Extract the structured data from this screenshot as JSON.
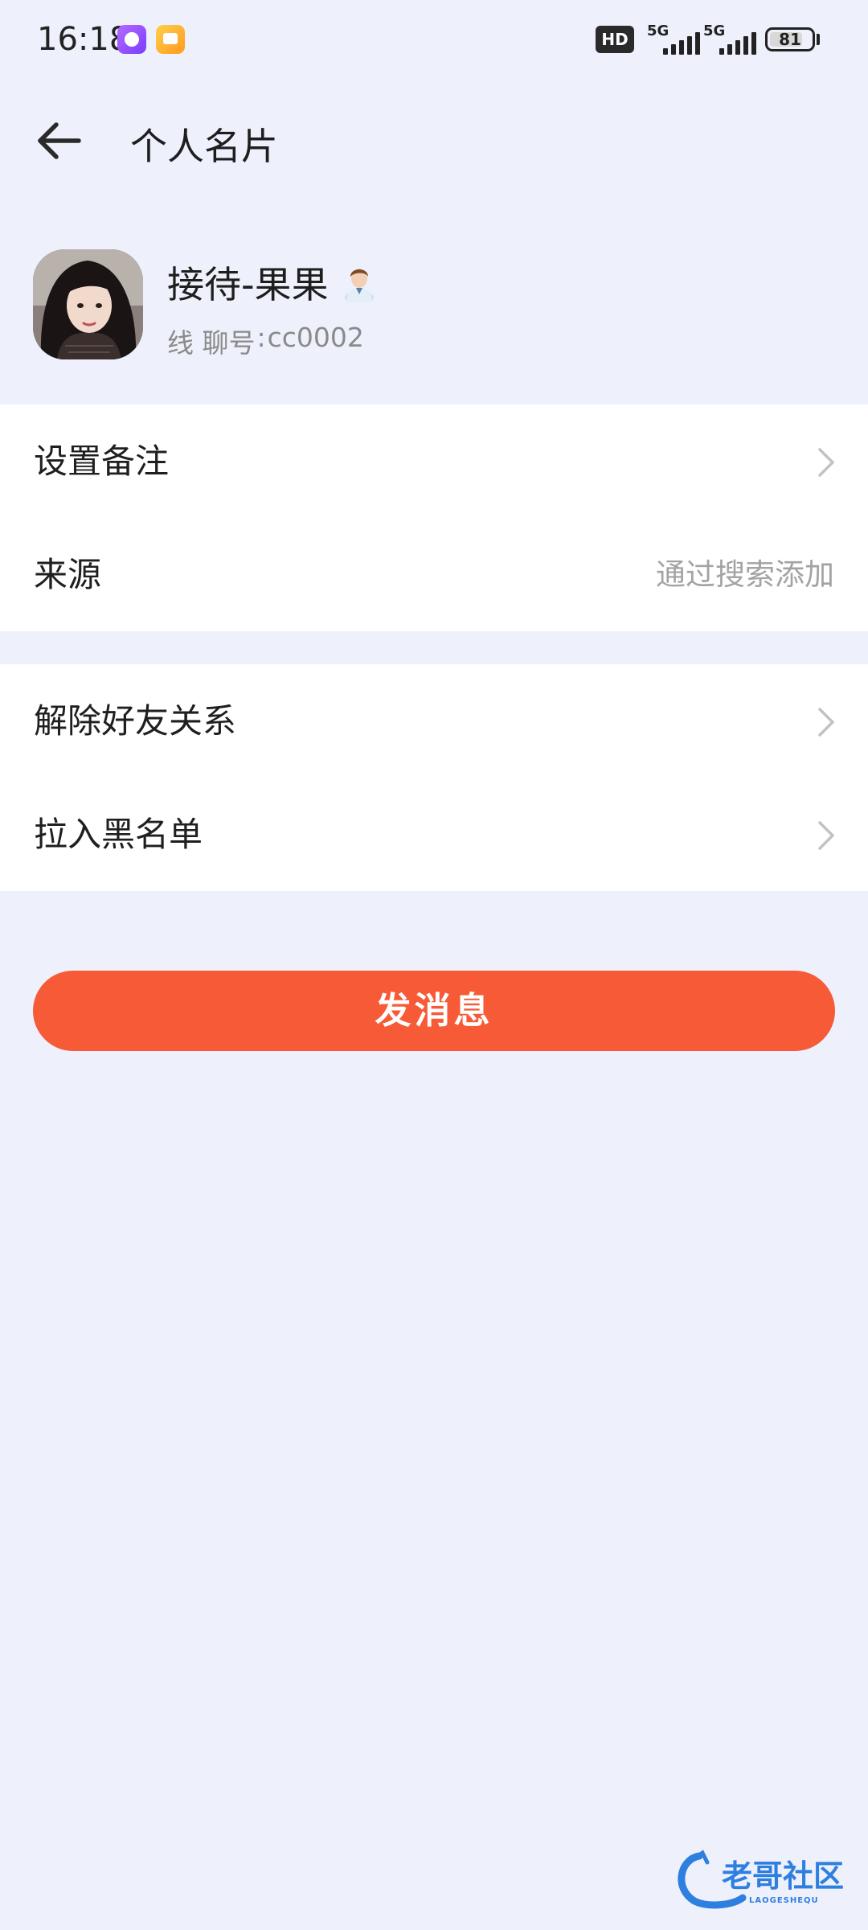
{
  "status_bar": {
    "time": "16:18",
    "hd_label": "HD",
    "network_1": "5G",
    "network_2": "5G",
    "battery_level": "81",
    "icons": [
      "app-notification-icon",
      "message-notification-icon",
      "signal-icon",
      "battery-icon"
    ]
  },
  "header": {
    "title": "个人名片",
    "back_icon": "arrow-left-icon"
  },
  "profile": {
    "name": "接待-果果",
    "id_label": "线 聊号",
    "id_separator": ":",
    "id_value": "cc0002",
    "badge_icon": "staff-icon"
  },
  "settings": {
    "remark_label": "设置备注",
    "source_label": "来源",
    "source_value": "通过搜索添加"
  },
  "actions": {
    "unfriend_label": "解除好友关系",
    "blacklist_label": "拉入黑名单"
  },
  "send_button_label": "发消息",
  "watermark": {
    "text": "老哥社区",
    "subtext": "LAOGESHEQU"
  },
  "colors": {
    "background": "#eef1fb",
    "card": "#ffffff",
    "accent": "#f65a36",
    "secondary_text": "#8a8a8a"
  }
}
